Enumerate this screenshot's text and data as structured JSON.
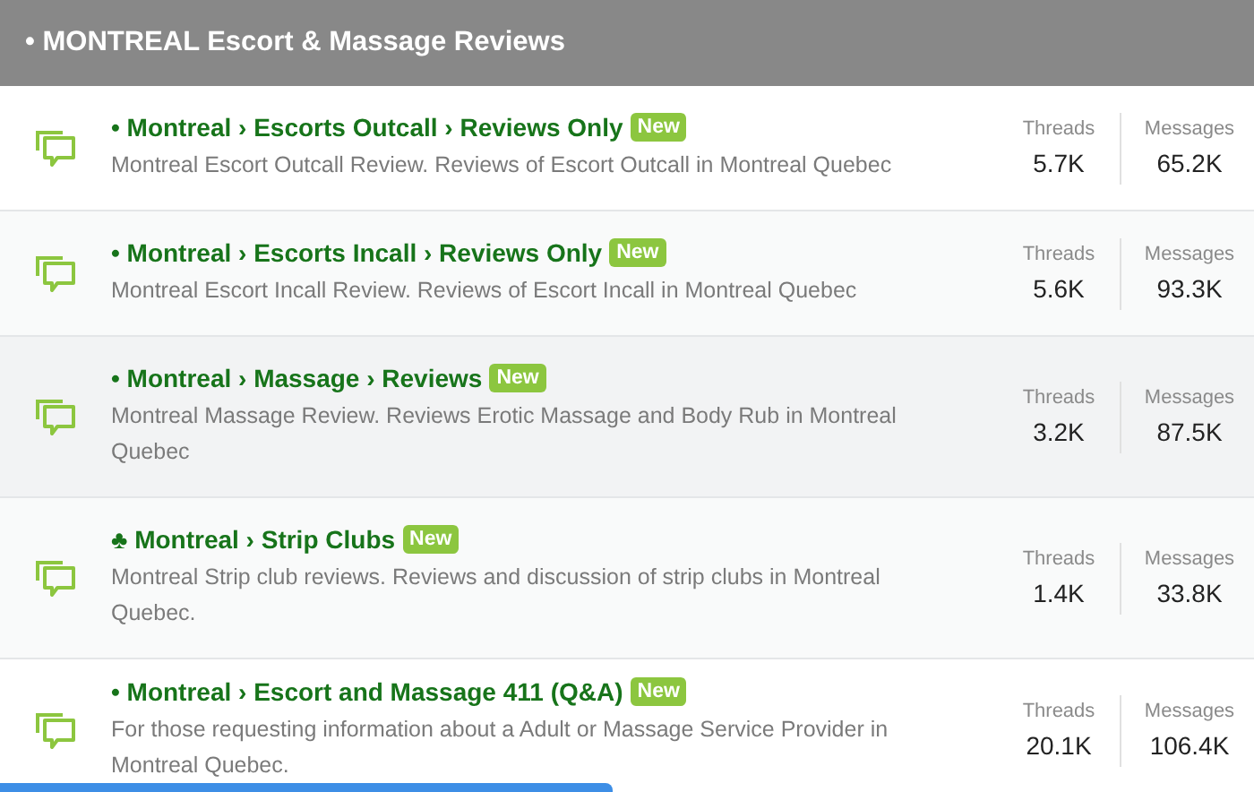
{
  "header": {
    "title": "• MONTREAL Escort & Massage Reviews"
  },
  "forums": [
    {
      "title": "• Montreal › Escorts Outcall › Reviews Only",
      "badge": "New",
      "description": "Montreal Escort Outcall Review. Reviews of Escort Outcall in Montreal Quebec",
      "threads_label": "Threads",
      "threads": "5.7K",
      "messages_label": "Messages",
      "messages": "65.2K",
      "kind": "plain"
    },
    {
      "title": "• Montreal › Escorts Incall › Reviews Only",
      "badge": "New",
      "description": "Montreal Escort Incall Review. Reviews of Escort Incall in Montreal Quebec",
      "threads_label": "Threads",
      "threads": "5.6K",
      "messages_label": "Messages",
      "messages": "93.3K",
      "kind": "shaded"
    },
    {
      "title": "• Montreal › Massage › Reviews",
      "badge": "New",
      "description": "Montreal Massage Review. Reviews Erotic Massage and Body Rub in Montreal Quebec",
      "threads_label": "Threads",
      "threads": "3.2K",
      "messages_label": "Messages",
      "messages": "87.5K",
      "kind": "hovered"
    },
    {
      "title": "♣ Montreal › Strip Clubs",
      "badge": "New",
      "description": "Montreal Strip club reviews. Reviews and discussion of strip clubs in Montreal Quebec.",
      "threads_label": "Threads",
      "threads": "1.4K",
      "messages_label": "Messages",
      "messages": "33.8K",
      "kind": "shaded"
    },
    {
      "title": "• Montreal › Escort and Massage 411 (Q&A)",
      "badge": "New",
      "description": "For those requesting information about a Adult or Massage Service Provider in Montreal Quebec.",
      "threads_label": "Threads",
      "threads": "20.1K",
      "messages_label": "Messages",
      "messages": "106.4K",
      "kind": "plain"
    }
  ]
}
